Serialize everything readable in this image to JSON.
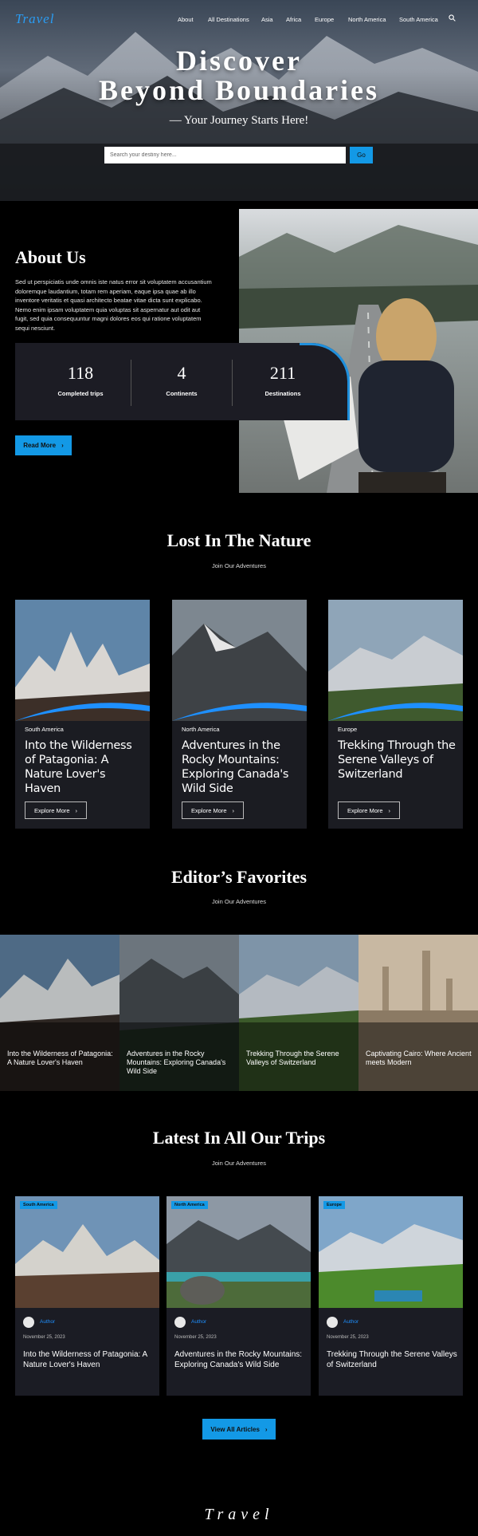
{
  "brand": {
    "logo": "Travel",
    "accent": "#1399e6"
  },
  "nav": {
    "items": [
      "About",
      "All Destinations",
      "Asia",
      "Africa",
      "Europe",
      "North America",
      "South America"
    ],
    "search_icon": "search-icon"
  },
  "hero": {
    "title_line1": "Discover",
    "title_line2": "Beyond Boundaries",
    "subtitle": "— Your Journey Starts Here!",
    "search_placeholder": "Search your destiny here...",
    "go_label": "Go"
  },
  "about": {
    "title": "About Us",
    "text": "Sed ut perspiciatis unde omnis iste natus error sit voluptatem accusantium doloremque laudantium, totam rem aperiam, eaque ipsa quae ab illo inventore veritatis et quasi architecto beatae vitae dicta sunt explicabo. Nemo enim ipsam voluptatem quia voluptas sit aspernatur aut odit aut fugit, sed quia consequuntur magni dolores eos qui ratione voluptatem sequi nesciunt.",
    "stats": [
      {
        "value": "118",
        "label": "Completed trips"
      },
      {
        "value": "4",
        "label": "Continents"
      },
      {
        "value": "211",
        "label": "Destinations"
      }
    ],
    "read_more": "Read More"
  },
  "nature": {
    "title": "Lost In The Nature",
    "subtitle": "Join Our Adventures",
    "cards": [
      {
        "category": "South America",
        "title": "Into the Wilderness of Patagonia: A Nature Lover's Haven",
        "button": "Explore More"
      },
      {
        "category": "North America",
        "title": "Adventures in the Rocky Mountains: Exploring Canada's Wild Side",
        "button": "Explore More"
      },
      {
        "category": "Europe",
        "title": "Trekking Through the Serene Valleys of Switzerland",
        "button": "Explore More"
      }
    ]
  },
  "favorites": {
    "title": "Editor’s Favorites",
    "subtitle": "Join Our Adventures",
    "items": [
      "Into the Wilderness of Patagonia: A Nature Lover's Haven",
      "Adventures in the Rocky Mountains: Exploring Canada's Wild Side",
      "Trekking Through the Serene Valleys of Switzerland",
      "Captivating Cairo: Where Ancient meets Modern"
    ]
  },
  "latest": {
    "title": "Latest In All Our Trips",
    "subtitle": "Join Our Adventures",
    "cards": [
      {
        "badge": "South America",
        "author": "Author",
        "date": "November 25, 2023",
        "title": "Into the Wilderness of Patagonia: A Nature Lover's Haven"
      },
      {
        "badge": "North America",
        "author": "Author",
        "date": "November 25, 2023",
        "title": "Adventures in the Rocky Mountains: Exploring Canada's Wild Side"
      },
      {
        "badge": "Europe",
        "author": "Author",
        "date": "November 25, 2023",
        "title": "Trekking Through the Serene Valleys of Switzerland"
      }
    ],
    "view_all": "View All Articles"
  },
  "footer": {
    "logo": "Travel"
  }
}
